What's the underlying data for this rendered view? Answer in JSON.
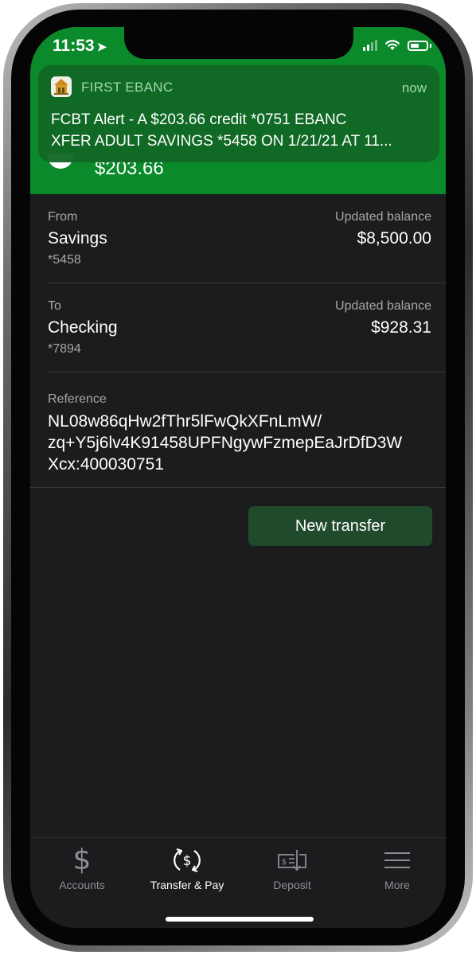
{
  "status_bar": {
    "time": "11:53"
  },
  "header": {
    "amount": "$203.66"
  },
  "notification": {
    "app_name": "FIRST EBANC",
    "time": "now",
    "line1": "FCBT Alert - A $203.66 credit *0751 EBANC",
    "line2": "XFER ADULT SAVINGS *5458 ON 1/21/21 AT 11..."
  },
  "from": {
    "label": "From",
    "name": "Savings",
    "account": "*5458",
    "balance_label": "Updated balance",
    "balance": "$8,500.00"
  },
  "to": {
    "label": "To",
    "name": "Checking",
    "account": "*7894",
    "balance_label": "Updated balance",
    "balance": "$928.31"
  },
  "reference": {
    "label": "Reference",
    "line1": "NL08w86qHw2fThr5lFwQkXFnLmW/",
    "line2": "zq+Y5j6lv4K91458UPFNgywFzmepEaJrDfD3W",
    "line3": "Xcx:400030751"
  },
  "new_transfer_button": "New transfer",
  "tabbar": {
    "tabs": [
      {
        "label": "Accounts",
        "icon": "dollar-icon"
      },
      {
        "label": "Transfer & Pay",
        "icon": "transfer-pay-icon",
        "active": true
      },
      {
        "label": "Deposit",
        "icon": "check-deposit-icon"
      },
      {
        "label": "More",
        "icon": "menu-icon"
      }
    ]
  },
  "colors": {
    "header_green": "#0a8a2b",
    "notification_green": "#126826",
    "background": "#1c1c1e",
    "button_green": "#1f4a2c"
  }
}
